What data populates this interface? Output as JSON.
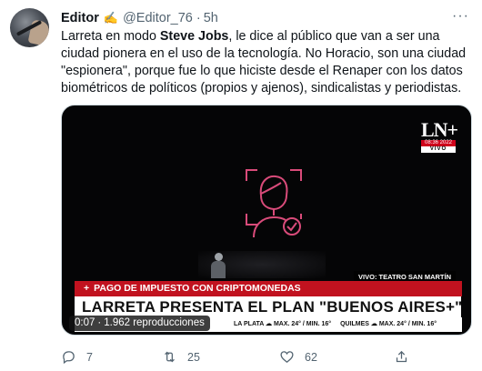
{
  "author": {
    "name": "Editor",
    "emoji": "✍",
    "handle": "@Editor_76",
    "separator": "·",
    "time": "5h"
  },
  "more_label": "···",
  "text": {
    "part1": "Larreta en modo ",
    "bold": "Steve Jobs",
    "part2": ", le dice al público que van a ser una ciudad pionera en el uso de la tecnología. No Horacio, son una ciudad \"espionera\", porque fue lo que hiciste desde el Renaper con los datos biométricos de políticos (propios y ajenos), sindicalistas y periodistas."
  },
  "video": {
    "channel_logo": "LN+",
    "channel_time": "08:36 2022",
    "channel_live": "VIVO",
    "live_tag": "VIVO: TEATRO SAN MARTÍN",
    "ticker_top": "PAGO DE IMPUESTO CON CRIPTOMONEDAS",
    "ticker_plus": "+",
    "headline": "LARRETA PRESENTA EL PLAN \"BUENOS AIRES+\"",
    "weather": [
      "LA PLATA ☁ MAX. 24° / MIN. 16°",
      "QUILMES ☁ MAX. 24° / MIN. 16°"
    ],
    "elapsed": "0:07",
    "views": "1.962 reproducciones",
    "meta_sep": "·"
  },
  "actions": {
    "reply_count": "7",
    "retweet_count": "25",
    "like_count": "62",
    "icons": [
      "reply-icon",
      "retweet-icon",
      "like-icon",
      "share-icon"
    ]
  },
  "colors": {
    "ticker_red": "#c1121f",
    "secondary_text": "#536471",
    "face_icon_pink": "#d94b7a"
  }
}
